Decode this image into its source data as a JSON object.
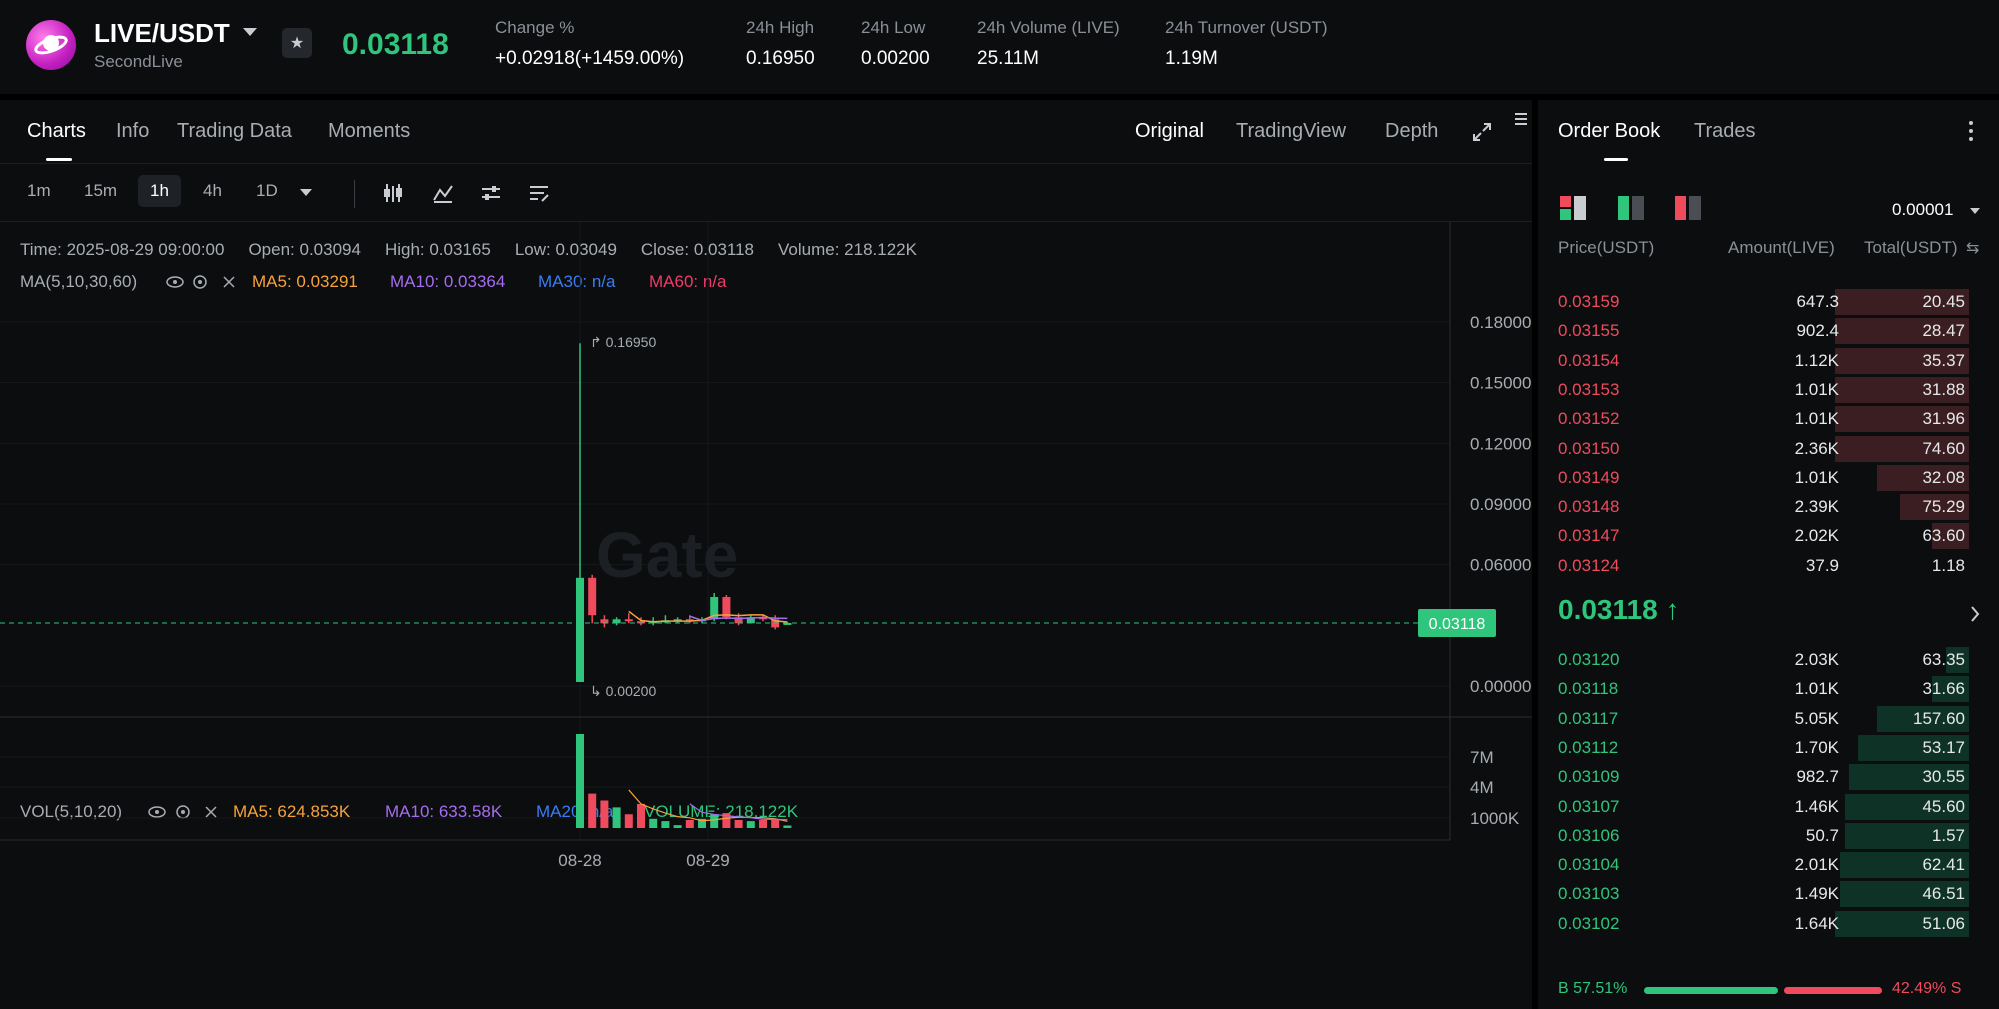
{
  "header": {
    "pair": "LIVE/USDT",
    "name": "SecondLive",
    "last_price": "0.03118",
    "change_label": "Change %",
    "change_value": "+0.02918(+1459.00%)",
    "high_label": "24h High",
    "high_value": "0.16950",
    "low_label": "24h Low",
    "low_value": "0.00200",
    "volume_label": "24h Volume (LIVE)",
    "volume_value": "25.11M",
    "turnover_label": "24h Turnover (USDT)",
    "turnover_value": "1.19M"
  },
  "chart_tabs": [
    "Charts",
    "Info",
    "Trading Data",
    "Moments"
  ],
  "view_tabs": [
    "Original",
    "TradingView",
    "Depth"
  ],
  "timeframes": [
    "1m",
    "15m",
    "1h",
    "4h",
    "1D"
  ],
  "active_timeframe": "1h",
  "candle_info": {
    "time": "Time: 2025-08-29 09:00:00",
    "open": "Open: 0.03094",
    "high": "High: 0.03165",
    "low": "Low: 0.03049",
    "close": "Close: 0.03118",
    "volume": "Volume: 218.122K"
  },
  "ma_indicator": {
    "label": "MA(5,10,30,60)",
    "ma5": "MA5: 0.03291",
    "ma10": "MA10: 0.03364",
    "ma30": "MA30: n/a",
    "ma60": "MA60: n/a"
  },
  "vol_indicator": {
    "label": "VOL(5,10,20)",
    "ma5": "MA5: 624.853K",
    "ma10": "MA10: 633.58K",
    "ma20": "MA20: n/a",
    "volume": "VOLUME: 218.122K"
  },
  "colors": {
    "up": "#2fc57c",
    "down": "#f04a5d",
    "ma5": "#f7a23b",
    "ma10": "#a66cf0",
    "ma30": "#3b7cf0",
    "ma60": "#f03b6a"
  },
  "chart_data": {
    "type": "candlestick",
    "price_axis_ticks": [
      "0.18000",
      "0.15000",
      "0.12000",
      "0.09000",
      "0.06000",
      "0.00000"
    ],
    "volume_axis_ticks": [
      "7M",
      "4M",
      "1000K"
    ],
    "x_labels": [
      "08-28",
      "08-29"
    ],
    "current_price_label": "0.03118",
    "high_marker": "0.16950",
    "low_marker": "0.00200",
    "watermark": "Gate",
    "candles": [
      {
        "o": 0.002,
        "h": 0.1695,
        "l": 0.002,
        "c": 0.0535,
        "v": 8200000
      },
      {
        "o": 0.0535,
        "h": 0.055,
        "l": 0.031,
        "c": 0.035,
        "v": 3000000
      },
      {
        "o": 0.033,
        "h": 0.035,
        "l": 0.029,
        "c": 0.031,
        "v": 2400000
      },
      {
        "o": 0.031,
        "h": 0.034,
        "l": 0.03,
        "c": 0.033,
        "v": 1800000
      },
      {
        "o": 0.033,
        "h": 0.036,
        "l": 0.031,
        "c": 0.032,
        "v": 1200000
      },
      {
        "o": 0.032,
        "h": 0.034,
        "l": 0.03,
        "c": 0.031,
        "v": 2100000
      },
      {
        "o": 0.031,
        "h": 0.034,
        "l": 0.03,
        "c": 0.032,
        "v": 800000
      },
      {
        "o": 0.032,
        "h": 0.035,
        "l": 0.031,
        "c": 0.0325,
        "v": 600000
      },
      {
        "o": 0.0325,
        "h": 0.034,
        "l": 0.031,
        "c": 0.033,
        "v": 250000
      },
      {
        "o": 0.033,
        "h": 0.035,
        "l": 0.031,
        "c": 0.032,
        "v": 700000
      },
      {
        "o": 0.032,
        "h": 0.034,
        "l": 0.031,
        "c": 0.033,
        "v": 800000
      },
      {
        "o": 0.033,
        "h": 0.046,
        "l": 0.032,
        "c": 0.044,
        "v": 1200000
      },
      {
        "o": 0.044,
        "h": 0.045,
        "l": 0.033,
        "c": 0.034,
        "v": 1300000
      },
      {
        "o": 0.034,
        "h": 0.036,
        "l": 0.03,
        "c": 0.031,
        "v": 700000
      },
      {
        "o": 0.031,
        "h": 0.035,
        "l": 0.031,
        "c": 0.034,
        "v": 600000
      },
      {
        "o": 0.034,
        "h": 0.035,
        "l": 0.032,
        "c": 0.033,
        "v": 700000
      },
      {
        "o": 0.033,
        "h": 0.035,
        "l": 0.028,
        "c": 0.029,
        "v": 700000
      },
      {
        "o": 0.03094,
        "h": 0.03165,
        "l": 0.03049,
        "c": 0.03118,
        "v": 218122
      }
    ]
  },
  "orderbook": {
    "tabs": [
      "Order Book",
      "Trades"
    ],
    "precision": "0.00001",
    "headers": {
      "price": "Price(USDT)",
      "amount": "Amount(LIVE)",
      "total": "Total(USDT)"
    },
    "asks": [
      {
        "price": "0.03159",
        "amount": "647.3",
        "total": "20.45",
        "depth": 0.29
      },
      {
        "price": "0.03155",
        "amount": "902.4",
        "total": "28.47",
        "depth": 0.29
      },
      {
        "price": "0.03154",
        "amount": "1.12K",
        "total": "35.37",
        "depth": 0.29
      },
      {
        "price": "0.03153",
        "amount": "1.01K",
        "total": "31.88",
        "depth": 0.29
      },
      {
        "price": "0.03152",
        "amount": "1.01K",
        "total": "31.96",
        "depth": 0.29
      },
      {
        "price": "0.03150",
        "amount": "2.36K",
        "total": "74.60",
        "depth": 0.29
      },
      {
        "price": "0.03149",
        "amount": "1.01K",
        "total": "32.08",
        "depth": 0.2
      },
      {
        "price": "0.03148",
        "amount": "2.39K",
        "total": "75.29",
        "depth": 0.15
      },
      {
        "price": "0.03147",
        "amount": "2.02K",
        "total": "63.60",
        "depth": 0.08
      },
      {
        "price": "0.03124",
        "amount": "37.9",
        "total": "1.18",
        "depth": 0.0
      }
    ],
    "mid_price": "0.03118",
    "bids": [
      {
        "price": "0.03120",
        "amount": "2.03K",
        "total": "63.35",
        "depth": 0.05
      },
      {
        "price": "0.03118",
        "amount": "1.01K",
        "total": "31.66",
        "depth": 0.08
      },
      {
        "price": "0.03117",
        "amount": "5.05K",
        "total": "157.60",
        "depth": 0.2
      },
      {
        "price": "0.03112",
        "amount": "1.70K",
        "total": "53.17",
        "depth": 0.24
      },
      {
        "price": "0.03109",
        "amount": "982.7",
        "total": "30.55",
        "depth": 0.26
      },
      {
        "price": "0.03107",
        "amount": "1.46K",
        "total": "45.60",
        "depth": 0.27
      },
      {
        "price": "0.03106",
        "amount": "50.7",
        "total": "1.57",
        "depth": 0.27
      },
      {
        "price": "0.03104",
        "amount": "2.01K",
        "total": "62.41",
        "depth": 0.28
      },
      {
        "price": "0.03103",
        "amount": "1.49K",
        "total": "46.51",
        "depth": 0.28
      },
      {
        "price": "0.03102",
        "amount": "1.64K",
        "total": "51.06",
        "depth": 0.29
      }
    ],
    "buy_ratio": "B 57.51%",
    "sell_ratio": "42.49% S",
    "buy_fraction": 0.5751
  }
}
